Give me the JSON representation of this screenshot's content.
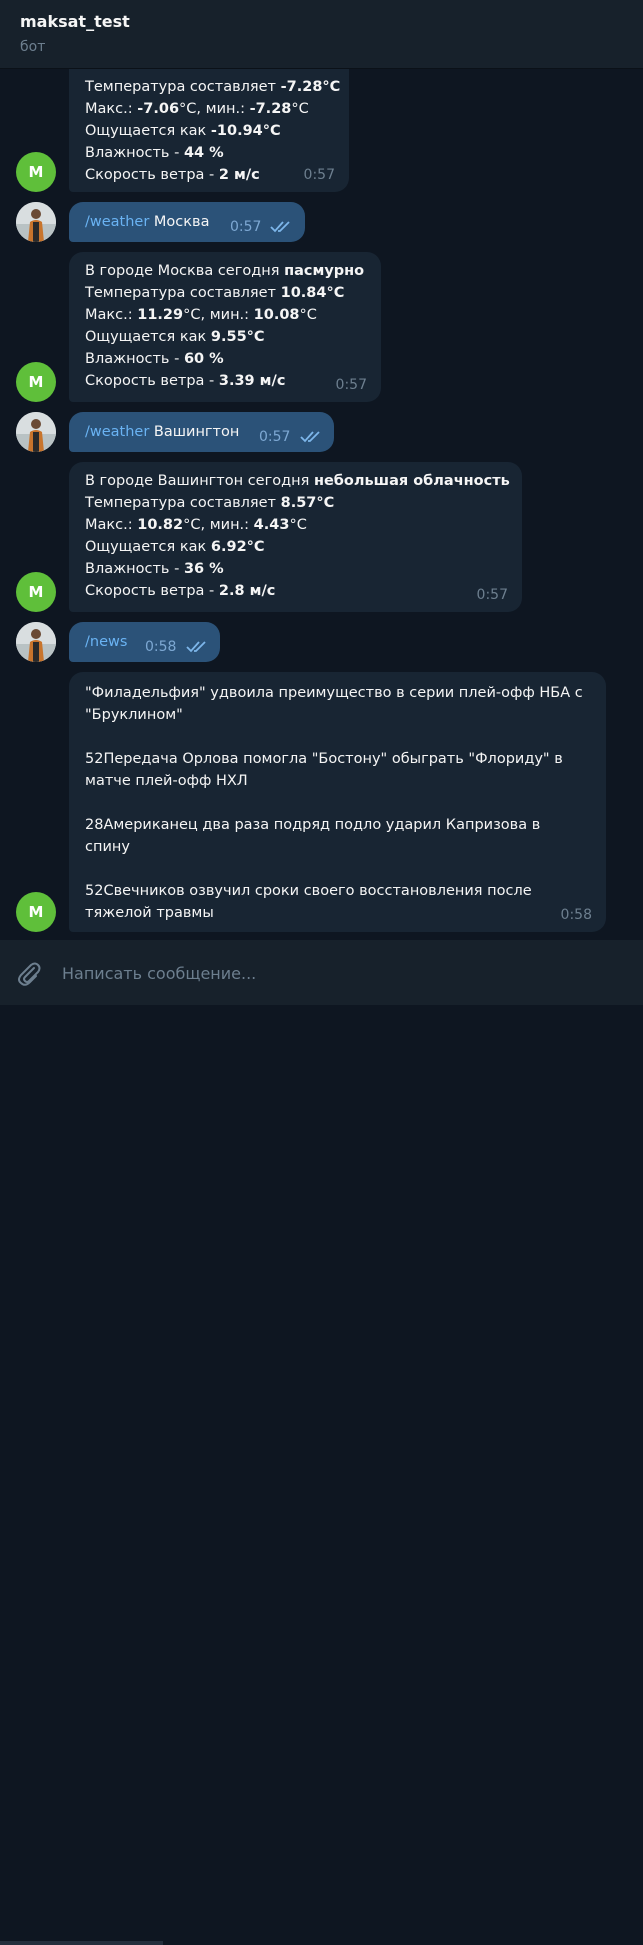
{
  "header": {
    "title": "maksat_test",
    "subtitle": "бот"
  },
  "avatars": {
    "bot_letter": "M"
  },
  "messages": [
    {
      "id": "bot1",
      "lines": [
        {
          "pre": "Температура составляет ",
          "bold": "-7.28°C",
          "post": ""
        },
        {
          "pre": "Макс.: ",
          "bold": "-7.06",
          "post": "°C, мин.: ",
          "bold2": "-7.28",
          "post2": "°C"
        },
        {
          "pre": "Ощущается как ",
          "bold": "-10.94°C",
          "post": ""
        },
        {
          "pre": "Влажность - ",
          "bold": "44 %",
          "post": ""
        },
        {
          "pre": "Скорость ветра - ",
          "bold": "2 м/с",
          "post": ""
        }
      ],
      "time": "0:57"
    },
    {
      "id": "user1",
      "command": "/weather",
      "text": " Москва",
      "time": "0:57"
    },
    {
      "id": "bot2",
      "lines": [
        {
          "pre": "В городе Москва сегодня ",
          "bold": "пасмурно",
          "post": ""
        },
        {
          "pre": "Температура составляет ",
          "bold": "10.84°C",
          "post": ""
        },
        {
          "pre": "Макс.: ",
          "bold": "11.29",
          "post": "°C, мин.: ",
          "bold2": "10.08",
          "post2": "°C"
        },
        {
          "pre": "Ощущается как ",
          "bold": "9.55°C",
          "post": ""
        },
        {
          "pre": "Влажность - ",
          "bold": "60 %",
          "post": ""
        },
        {
          "pre": "Скорость ветра - ",
          "bold": "3.39 м/с",
          "post": ""
        }
      ],
      "time": "0:57"
    },
    {
      "id": "user2",
      "command": "/weather",
      "text": " Вашингтон",
      "time": "0:57"
    },
    {
      "id": "bot3",
      "lines": [
        {
          "pre": "В городе Вашингтон сегодня ",
          "bold": "небольшая облачность",
          "post": ""
        },
        {
          "pre": "Температура составляет ",
          "bold": "8.57°C",
          "post": ""
        },
        {
          "pre": "Макс.: ",
          "bold": "10.82",
          "post": "°C, мин.: ",
          "bold2": "4.43",
          "post2": "°C"
        },
        {
          "pre": "Ощущается как ",
          "bold": "6.92°C",
          "post": ""
        },
        {
          "pre": "Влажность - ",
          "bold": "36 %",
          "post": ""
        },
        {
          "pre": "Скорость ветра - ",
          "bold": "2.8 м/с",
          "post": ""
        }
      ],
      "time": "0:57"
    },
    {
      "id": "user3",
      "command": "/news",
      "text": "",
      "time": "0:58"
    },
    {
      "id": "bot4",
      "news": [
        [
          "\"Филадельфия\" удвоила преимущество в серии плей-офф НБА с",
          "\"Бруклином\""
        ],
        [
          "52Передача Орлова помогла \"Бостону\" обыграть \"Флориду\" в",
          "матче плей-офф НХЛ"
        ],
        [
          "28Американец два раза подряд подло ударил Капризова в",
          "спину"
        ],
        [
          "52Свечников озвучил сроки своего восстановления после",
          "тяжелой травмы"
        ]
      ],
      "time": "0:58"
    }
  ],
  "composer": {
    "placeholder": "Написать сообщение..."
  },
  "colors": {
    "background": "#0e1621",
    "incoming_bubble": "#182533",
    "outgoing_bubble": "#2b5278",
    "command_link": "#6ab3f3",
    "bot_avatar": "#5fbf3a"
  }
}
